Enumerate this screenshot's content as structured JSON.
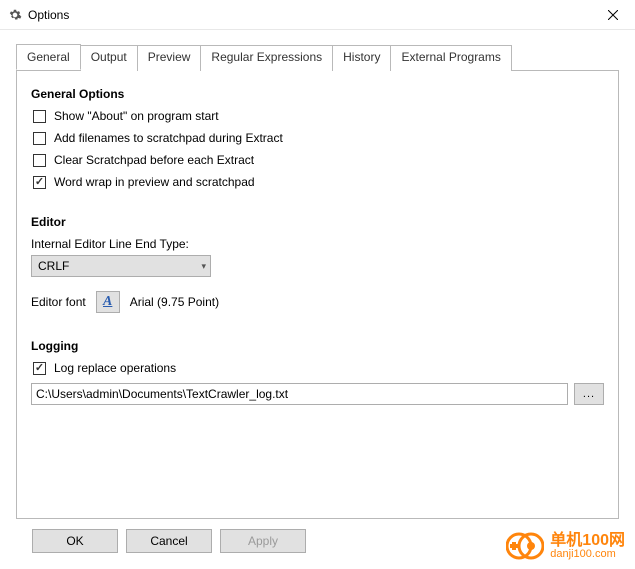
{
  "window": {
    "title": "Options"
  },
  "tabs": [
    {
      "label": "General"
    },
    {
      "label": "Output"
    },
    {
      "label": "Preview"
    },
    {
      "label": "Regular Expressions"
    },
    {
      "label": "History"
    },
    {
      "label": "External Programs"
    }
  ],
  "general_options": {
    "heading": "General Options",
    "items": [
      {
        "label": "Show \"About\" on program start",
        "checked": false
      },
      {
        "label": "Add filenames to scratchpad during Extract",
        "checked": false
      },
      {
        "label": "Clear Scratchpad before each Extract",
        "checked": false
      },
      {
        "label": "Word wrap in preview and scratchpad",
        "checked": true
      }
    ]
  },
  "editor": {
    "heading": "Editor",
    "line_end_label": "Internal Editor Line End Type:",
    "line_end_value": "CRLF",
    "font_label": "Editor font",
    "font_value": "Arial (9.75 Point)"
  },
  "logging": {
    "heading": "Logging",
    "log_replace_label": "Log replace operations",
    "log_replace_checked": true,
    "path": "C:\\Users\\admin\\Documents\\TextCrawler_log.txt",
    "browse_label": "..."
  },
  "buttons": {
    "ok": "OK",
    "cancel": "Cancel",
    "apply": "Apply"
  },
  "watermark": {
    "cn": "单机100网",
    "url": "danji100.com"
  }
}
